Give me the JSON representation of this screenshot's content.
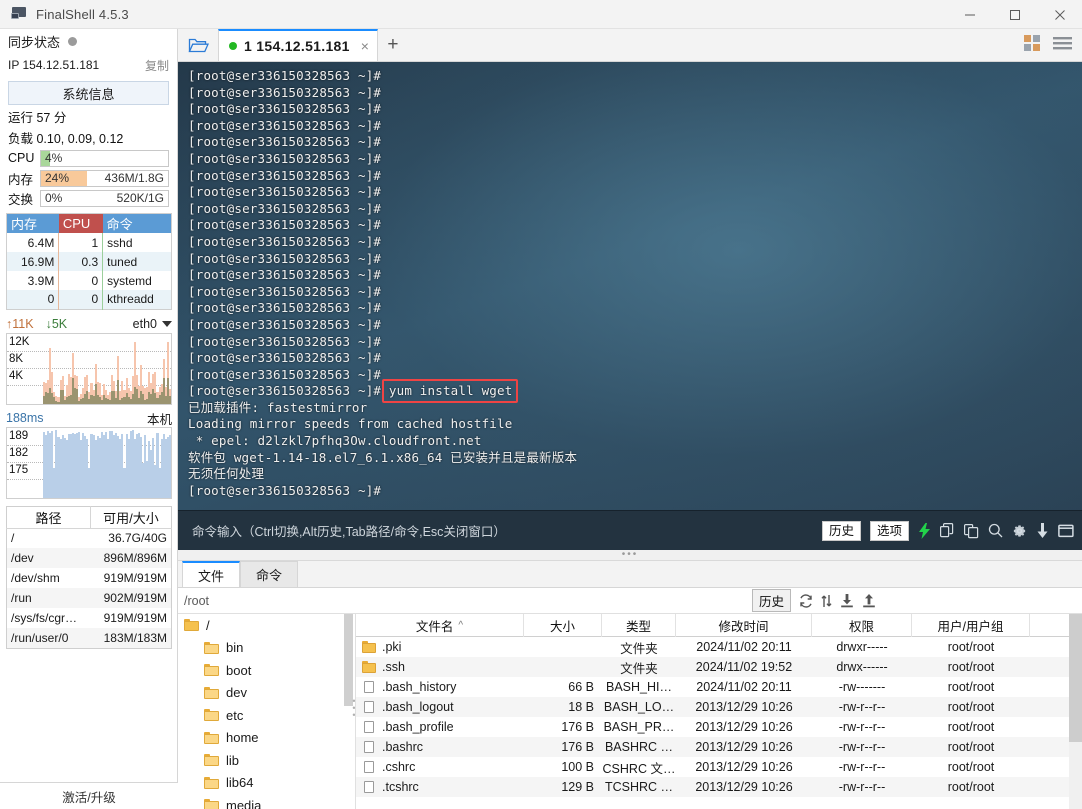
{
  "window": {
    "title": "FinalShell 4.5.3",
    "app_icon": "monitor-icon",
    "minimize": "minimize-icon",
    "maximize": "maximize-icon",
    "close": "close-icon"
  },
  "sidebar": {
    "sync_label": "同步状态",
    "ip_label": "IP",
    "ip_value": "154.12.51.181",
    "copy_label": "复制",
    "sysinfo_button": "系统信息",
    "uptime": "运行 57 分",
    "load": "负载 0.10, 0.09, 0.12",
    "meters": [
      {
        "label": "CPU",
        "percent": "4%",
        "amount": "",
        "fill_pct": 7,
        "color": "#a9d79a"
      },
      {
        "label": "内存",
        "percent": "24%",
        "amount": "436M/1.8G",
        "fill_pct": 36,
        "color": "#f8c99a"
      },
      {
        "label": "交换",
        "percent": "0%",
        "amount": "520K/1G",
        "fill_pct": 0,
        "color": "#f8c99a"
      }
    ],
    "proc_headers": [
      "内存",
      "CPU",
      "命令"
    ],
    "proc_rows": [
      {
        "mem": "6.4M",
        "cpu": "1",
        "cmd": "sshd"
      },
      {
        "mem": "16.9M",
        "cpu": "0.3",
        "cmd": "tuned"
      },
      {
        "mem": "3.9M",
        "cpu": "0",
        "cmd": "systemd"
      },
      {
        "mem": "0",
        "cpu": "0",
        "cmd": "kthreadd"
      }
    ],
    "net": {
      "up": "11K",
      "down": "5K",
      "interface": "eth0",
      "y_labels": [
        "12K",
        "8K",
        "4K"
      ]
    },
    "ping": {
      "value": "188ms",
      "host": "本机",
      "y_labels": [
        "189",
        "182",
        "175"
      ]
    },
    "disk_headers": [
      "路径",
      "可用/大小"
    ],
    "disk_rows": [
      {
        "path": "/",
        "size": "36.7G/40G"
      },
      {
        "path": "/dev",
        "size": "896M/896M"
      },
      {
        "path": "/dev/shm",
        "size": "919M/919M"
      },
      {
        "path": "/run",
        "size": "902M/919M"
      },
      {
        "path": "/sys/fs/cgr…",
        "size": "919M/919M"
      },
      {
        "path": "/run/user/0",
        "size": "183M/183M"
      }
    ],
    "activate_label": "激活/升级"
  },
  "tabstrip": {
    "folder_icon": "open-folder-icon",
    "tab_label": "1 154.12.51.181",
    "tab_close": "×",
    "tab_add": "+",
    "grid_icon": "grid-view-icon",
    "menu_icon": "hamburger-menu-icon"
  },
  "terminal": {
    "prompt": "[root@ser336150328563 ~]#",
    "lines": [
      "[root@ser336150328563 ~]#",
      "[root@ser336150328563 ~]#",
      "[root@ser336150328563 ~]#",
      "[root@ser336150328563 ~]#",
      "[root@ser336150328563 ~]#",
      "[root@ser336150328563 ~]#",
      "[root@ser336150328563 ~]#",
      "[root@ser336150328563 ~]#",
      "[root@ser336150328563 ~]#",
      "[root@ser336150328563 ~]#",
      "[root@ser336150328563 ~]#",
      "[root@ser336150328563 ~]#",
      "[root@ser336150328563 ~]#",
      "[root@ser336150328563 ~]#",
      "[root@ser336150328563 ~]#",
      "[root@ser336150328563 ~]#",
      "[root@ser336150328563 ~]#",
      "[root@ser336150328563 ~]#",
      "[root@ser336150328563 ~]#",
      "[root@ser336150328563 ~]# yum install wget",
      "已加载插件: fastestmirror",
      "Loading mirror speeds from cached hostfile",
      " * epel: d2lzkl7pfhq3Ow.cloudfront.net",
      "软件包 wget-1.14-18.el7_6.1.x86_64 已安装并且是最新版本",
      "无须任何处理",
      "[root@ser336150328563 ~]#"
    ],
    "highlighted_command": "yum install wget",
    "highlight_color": "#ef4444"
  },
  "cmdbar": {
    "placeholder": "命令输入（Ctrl切换,Alt历史,Tab路径/命令,Esc关闭窗口）",
    "history_label": "历史",
    "options_label": "选项",
    "icons": [
      "lightning-icon",
      "copy-icon",
      "paste-icon",
      "search-icon",
      "gear-icon",
      "download-icon",
      "window-icon"
    ]
  },
  "filemanager": {
    "tabs": [
      {
        "label": "文件",
        "active": true
      },
      {
        "label": "命令",
        "active": false
      }
    ],
    "path": "/root",
    "history_label": "历史",
    "toolbar_icons": [
      "refresh-icon",
      "sort-icon",
      "download-icon",
      "upload-icon"
    ],
    "tree": [
      {
        "name": "/",
        "root": true,
        "open": true
      },
      {
        "name": "bin",
        "root": false,
        "open": false
      },
      {
        "name": "boot",
        "root": false,
        "open": false
      },
      {
        "name": "dev",
        "root": false,
        "open": false
      },
      {
        "name": "etc",
        "root": false,
        "open": false
      },
      {
        "name": "home",
        "root": false,
        "open": false
      },
      {
        "name": "lib",
        "root": false,
        "open": false
      },
      {
        "name": "lib64",
        "root": false,
        "open": false
      },
      {
        "name": "media",
        "root": false,
        "open": false
      }
    ],
    "columns": [
      "文件名",
      "大小",
      "类型",
      "修改时间",
      "权限",
      "用户/用户组"
    ],
    "sort_indicator": "^",
    "rows": [
      {
        "name": ".pki",
        "icon": "folder-icon",
        "size": "",
        "type": "文件夹",
        "time": "2024/11/02 20:11",
        "perm": "drwxr-----",
        "owner": "root/root"
      },
      {
        "name": ".ssh",
        "icon": "folder-icon",
        "size": "",
        "type": "文件夹",
        "time": "2024/11/02 19:52",
        "perm": "drwx------",
        "owner": "root/root"
      },
      {
        "name": ".bash_history",
        "icon": "file-icon",
        "size": "66 B",
        "type": "BASH_HI…",
        "time": "2024/11/02 20:11",
        "perm": "-rw-------",
        "owner": "root/root"
      },
      {
        "name": ".bash_logout",
        "icon": "file-icon",
        "size": "18 B",
        "type": "BASH_LO…",
        "time": "2013/12/29 10:26",
        "perm": "-rw-r--r--",
        "owner": "root/root"
      },
      {
        "name": ".bash_profile",
        "icon": "file-icon",
        "size": "176 B",
        "type": "BASH_PR…",
        "time": "2013/12/29 10:26",
        "perm": "-rw-r--r--",
        "owner": "root/root"
      },
      {
        "name": ".bashrc",
        "icon": "file-icon",
        "size": "176 B",
        "type": "BASHRC …",
        "time": "2013/12/29 10:26",
        "perm": "-rw-r--r--",
        "owner": "root/root"
      },
      {
        "name": ".cshrc",
        "icon": "file-icon",
        "size": "100 B",
        "type": "CSHRC 文…",
        "time": "2013/12/29 10:26",
        "perm": "-rw-r--r--",
        "owner": "root/root"
      },
      {
        "name": ".tcshrc",
        "icon": "file-icon",
        "size": "129 B",
        "type": "TCSHRC …",
        "time": "2013/12/29 10:26",
        "perm": "-rw-r--r--",
        "owner": "root/root"
      }
    ]
  }
}
